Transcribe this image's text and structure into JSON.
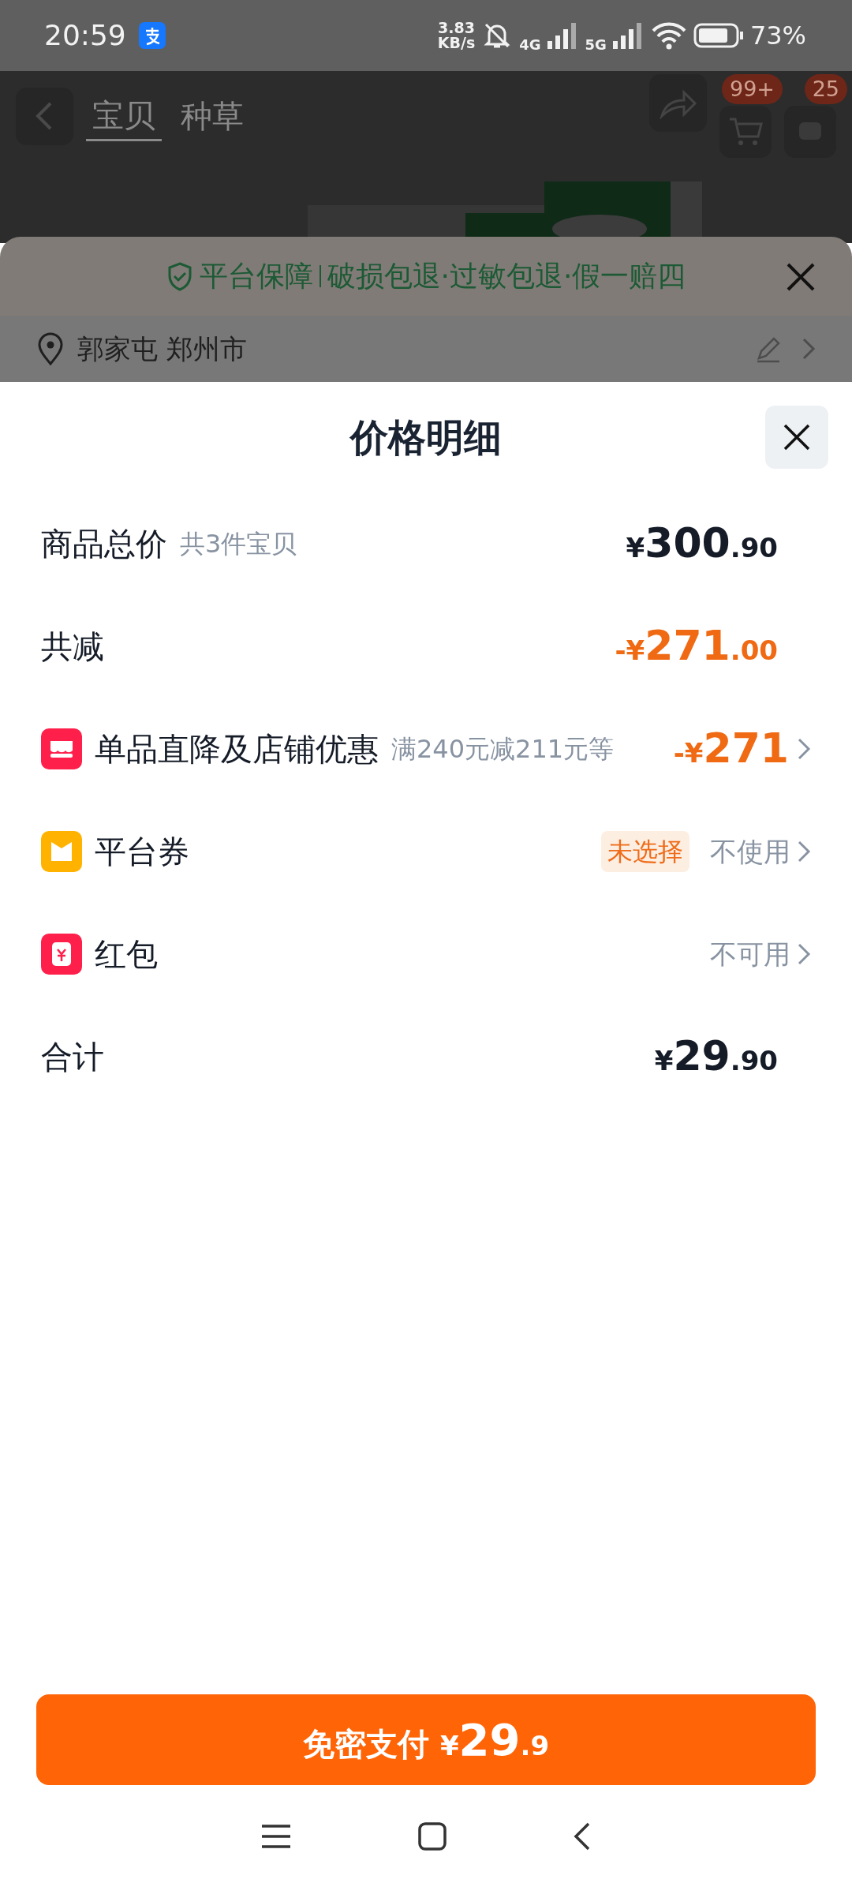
{
  "status_bar": {
    "time": "20:59",
    "speed_value": "3.83",
    "speed_unit": "KB/s",
    "network_labels": [
      "4G",
      "5G"
    ],
    "battery": "73%"
  },
  "background_page": {
    "tabs": [
      {
        "label": "宝贝",
        "selected": true
      },
      {
        "label": "种草",
        "selected": false
      }
    ],
    "cart_badge": "99+",
    "message_badge": "25",
    "guarantee": {
      "title": "平台保障",
      "items": "破损包退·过敏包退·假一赔四"
    },
    "address": "郭家屯 郑州市"
  },
  "price_sheet": {
    "title": "价格明细",
    "rows": [
      {
        "kind": "amount",
        "label": "商品总价",
        "note": "共3件宝贝",
        "currency": "¥",
        "amount_main": "300",
        "amount_fraction": ".90"
      },
      {
        "kind": "amount",
        "label": "共减",
        "sign": "-",
        "currency": "¥",
        "amount_main": "271",
        "amount_fraction": ".00"
      },
      {
        "kind": "shop",
        "label": "单品直降及店铺优惠",
        "note": "满240元减211元等",
        "sign": "-",
        "currency": "¥",
        "amount_main": "271"
      },
      {
        "kind": "coupon",
        "label": "平台券",
        "tag": "未选择",
        "value": "不使用"
      },
      {
        "kind": "packet",
        "label": "红包",
        "value": "不可用"
      },
      {
        "kind": "amount",
        "label": "合计",
        "currency": "¥",
        "amount_main": "29",
        "amount_fraction": ".90"
      }
    ]
  },
  "pay_button": {
    "label": "免密支付",
    "currency": "¥",
    "amount_main": "29",
    "amount_fraction": ".9"
  }
}
